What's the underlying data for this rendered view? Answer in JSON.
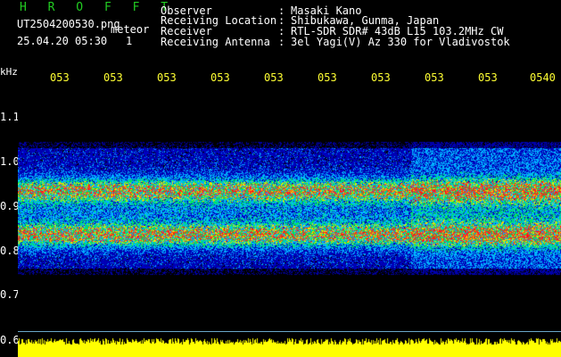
{
  "header": {
    "system_title": "H R O F F T",
    "file_name": "UT2504200530.png",
    "meteor_label": "meteor",
    "timestamp": "25.04.20 05:30",
    "meteor_count": "1"
  },
  "station_info": [
    {
      "label": "Observer",
      "value": "Masaki Kano"
    },
    {
      "label": "Receiving Location",
      "value": "Shibukawa, Gunma, Japan"
    },
    {
      "label": "Receiver",
      "value": "RTL-SDR SDR# 43dB L15 103.2MHz CW"
    },
    {
      "label": "Receiving Antenna",
      "value": "3el Yagi(V) Az 330 for Vladivostok"
    }
  ],
  "separator": ":",
  "axes": {
    "y_unit": "kHz",
    "y_ticks": [
      "1.1",
      "1.0",
      "0.9",
      "0.8",
      "0.7",
      "0.6"
    ],
    "x_ticks": [
      "053",
      "053",
      "053",
      "053",
      "053",
      "053",
      "053",
      "053",
      "053",
      "0540"
    ]
  },
  "colors": {
    "title_green": "#22cc22",
    "tick_yellow": "#ffff33",
    "background": "#000000"
  }
}
